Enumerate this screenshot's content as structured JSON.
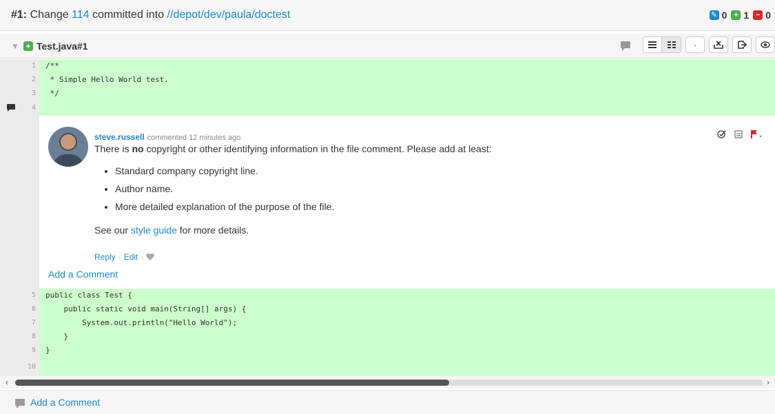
{
  "header": {
    "prefix": "#1:",
    "text_before": "Change",
    "change_number": "114",
    "text_middle": "committed into",
    "depot_path": "//depot/dev/paula/doctest",
    "stats": [
      {
        "icon": "edit-icon",
        "color": "#1e88c7",
        "count": "0"
      },
      {
        "icon": "add-icon",
        "color": "#4cae4c",
        "count": "1"
      },
      {
        "icon": "delete-icon",
        "color": "#d9282a",
        "count": "0"
      }
    ]
  },
  "file": {
    "name": "Test.java#1",
    "toolbar": {
      "dot": "·"
    }
  },
  "code_top": [
    {
      "num": "1",
      "text": "/**"
    },
    {
      "num": "2",
      "text": " * Simple Hello World test."
    },
    {
      "num": "3",
      "text": " */"
    },
    {
      "num": "4",
      "text": ""
    }
  ],
  "comment": {
    "author": "steve.russell",
    "meta": "commented 12 minutes ago",
    "text_pre": "There is ",
    "text_bold": "no",
    "text_post": " copyright or other identifying information in the file comment. Please add at least:",
    "items": [
      "Standard company copyright line.",
      "Author name.",
      "More detailed explanation of the purpose of the file."
    ],
    "see_pre": "See our ",
    "see_link": "style guide",
    "see_post": " for more details.",
    "reply": "Reply",
    "edit": "Edit",
    "sep": "·",
    "add_comment": "Add a Comment"
  },
  "code_bottom": [
    {
      "num": "5",
      "text": "public class Test {"
    },
    {
      "num": "6",
      "text": "    public static void main(String[] args) {"
    },
    {
      "num": "7",
      "text": "        System.out.println(\"Hello World\");"
    },
    {
      "num": "8",
      "text": "    }"
    },
    {
      "num": "9",
      "text": "}"
    },
    {
      "num": "10",
      "text": ""
    }
  ],
  "scrollbar": {
    "left": "‹",
    "right": "›",
    "position": 0.58
  },
  "footer": {
    "add_comment": "Add a Comment"
  }
}
